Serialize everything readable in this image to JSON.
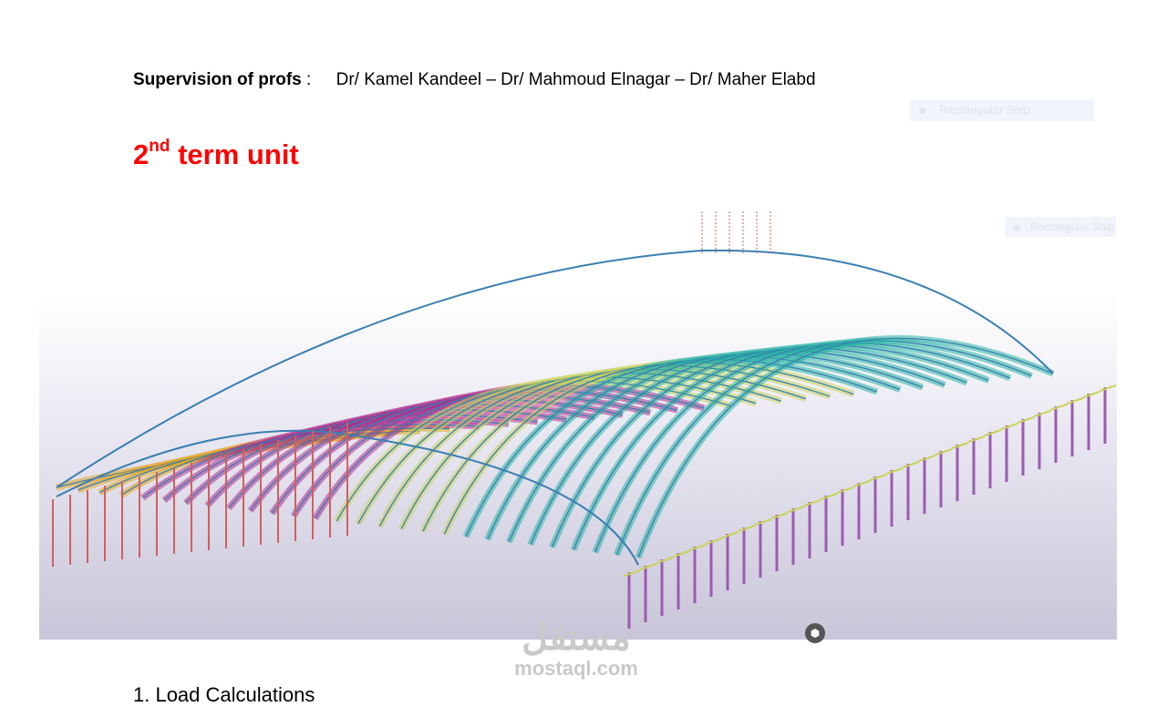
{
  "supervision": {
    "label": "Supervision of profs",
    "separator": ":",
    "names": "Dr/ Kamel Kandeel – Dr/ Mahmoud Elnagar – Dr/ Maher Elabd"
  },
  "term_title": {
    "number": "2",
    "ordinal_suffix": "nd",
    "text": "term unit",
    "color": "#ff0000"
  },
  "snip_labels": [
    "Rectangular Snip",
    "Rectangular Snip"
  ],
  "model_colors": {
    "arch": "#3a7fb0",
    "magenta_truss": "#b02c8c",
    "yellow_truss": "#c9d35a",
    "teal_truss": "#26b3a3",
    "orange_truss": "#e3a21a",
    "columns": "#9a5cb0",
    "red_columns": "#d06060"
  },
  "nav_cube_icon": "navigation-cube-icon",
  "watermark": {
    "arabic": "مستقل",
    "latin": "mostaql.com"
  },
  "section_heading": "1. Load Calculations"
}
